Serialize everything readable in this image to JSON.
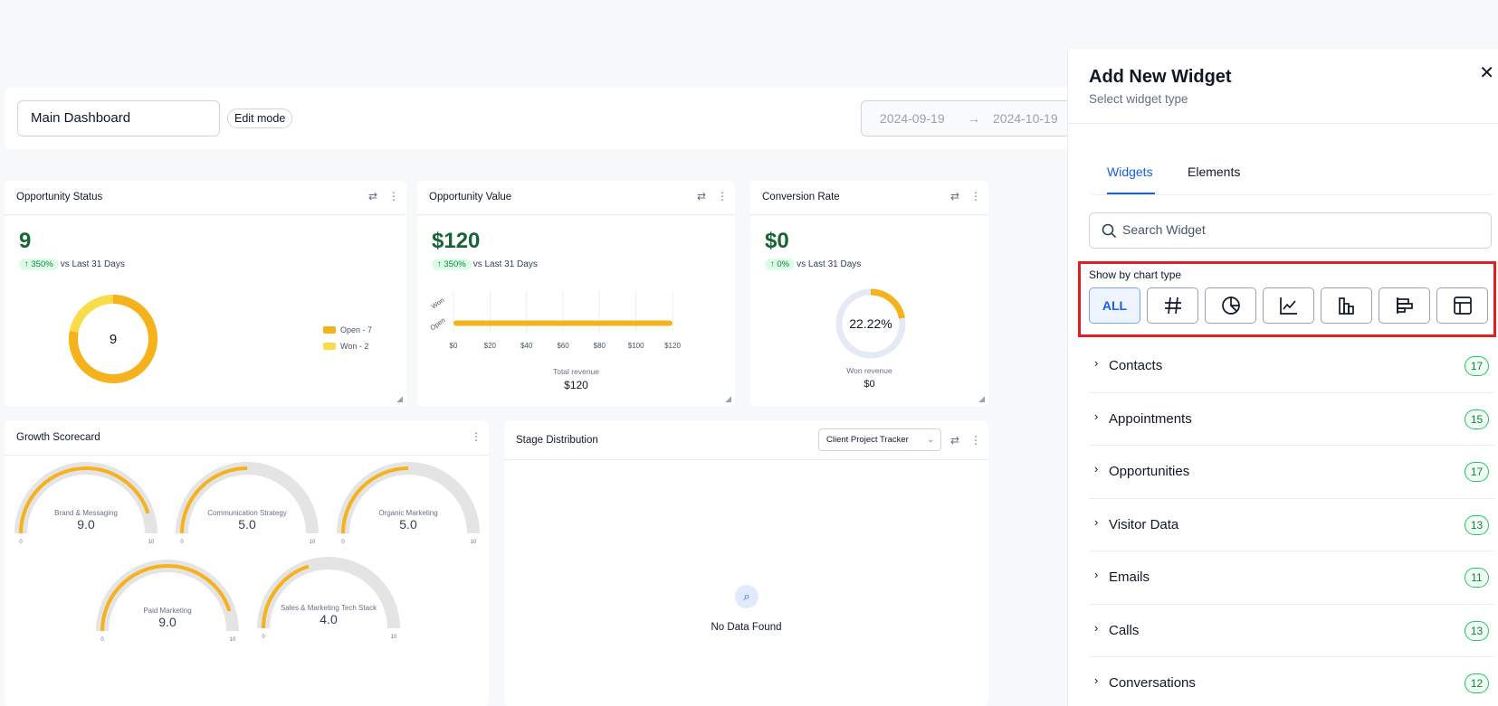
{
  "header": {
    "dashboard_name": "Main Dashboard",
    "edit_mode_label": "Edit mode",
    "date_start": "2024-09-19",
    "date_arrow": "→",
    "date_end": "2024-10-19"
  },
  "opportunity_status": {
    "title": "Opportunity Status",
    "value": "9",
    "change": "↑ 350%",
    "change_text": "vs Last 31 Days",
    "center_value": "9",
    "legend": [
      {
        "label": "Open - 7",
        "color": "#f5b21c"
      },
      {
        "label": "Won - 2",
        "color": "#f9dc4a"
      }
    ],
    "chart_data": {
      "type": "pie",
      "categories": [
        "Open",
        "Won"
      ],
      "values": [
        7,
        2
      ]
    }
  },
  "opportunity_value": {
    "title": "Opportunity Value",
    "value": "$120",
    "change": "↑ 350%",
    "change_text": "vs Last 31 Days",
    "xlabel": "Total revenue",
    "total": "$120",
    "chart_data": {
      "type": "bar",
      "categories": [
        "Won",
        "Open"
      ],
      "values": [
        0,
        120
      ],
      "xlim": [
        0,
        120
      ],
      "xticks": [
        "$0",
        "$20",
        "$40",
        "$60",
        "$80",
        "$100",
        "$120"
      ]
    }
  },
  "conversion_rate": {
    "title": "Conversion Rate",
    "value": "$0",
    "change": "↑ 0%",
    "change_text": "vs Last 31 Days",
    "ring_value": "22.22%",
    "ring_fraction": 0.2222,
    "sub_label": "Won revenue",
    "sub_value": "$0"
  },
  "growth_scorecard": {
    "title": "Growth Scorecard",
    "gauges": [
      {
        "label": "Brand & Messaging",
        "value": "9.0",
        "fraction": 0.9,
        "min": "0",
        "max": "10"
      },
      {
        "label": "Communication Strategy",
        "value": "5.0",
        "fraction": 0.5,
        "min": "0",
        "max": "10"
      },
      {
        "label": "Organic Marketing",
        "value": "5.0",
        "fraction": 0.5,
        "min": "0",
        "max": "10"
      },
      {
        "label": "Paid Marketing",
        "value": "9.0",
        "fraction": 0.9,
        "min": "0",
        "max": "10"
      },
      {
        "label": "Sales & Marketing Tech Stack",
        "value": "4.0",
        "fraction": 0.4,
        "min": "0",
        "max": "10"
      }
    ]
  },
  "stage_distribution": {
    "title": "Stage Distribution",
    "pipeline_select": "Client Project Tracker",
    "empty_text": "No Data Found"
  },
  "panel": {
    "title": "Add New Widget",
    "subtitle": "Select widget type",
    "tabs": [
      {
        "label": "Widgets"
      },
      {
        "label": "Elements"
      }
    ],
    "search_placeholder": "Search Widget",
    "chart_type_label": "Show by chart type",
    "chart_types": [
      {
        "label": "ALL",
        "icon": "all"
      },
      {
        "label": "",
        "icon": "number-icon"
      },
      {
        "label": "",
        "icon": "pie-chart-icon"
      },
      {
        "label": "",
        "icon": "line-chart-icon"
      },
      {
        "label": "",
        "icon": "bar-chart-icon"
      },
      {
        "label": "",
        "icon": "horizontal-bar-chart-icon"
      },
      {
        "label": "",
        "icon": "table-icon"
      }
    ],
    "categories": [
      {
        "label": "Contacts",
        "count": "17"
      },
      {
        "label": "Appointments",
        "count": "15"
      },
      {
        "label": "Opportunities",
        "count": "17"
      },
      {
        "label": "Visitor Data",
        "count": "13"
      },
      {
        "label": "Emails",
        "count": "11"
      },
      {
        "label": "Calls",
        "count": "13"
      },
      {
        "label": "Conversations",
        "count": "12"
      }
    ]
  },
  "colors": {
    "accent": "#155eef",
    "gauge_fill": "#f5b21c",
    "positive": "#166534",
    "highlight": "#e11d26"
  }
}
